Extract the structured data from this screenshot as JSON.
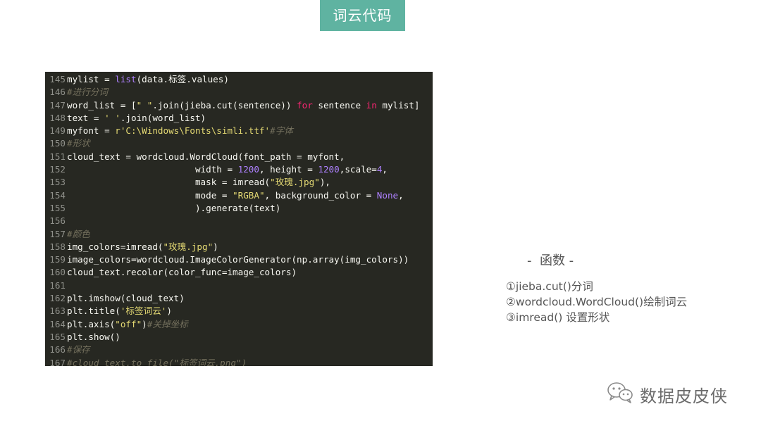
{
  "header": {
    "title": "词云代码"
  },
  "code": {
    "lines": [
      {
        "num": "145",
        "tokens": [
          {
            "t": "plain",
            "text": "mylist = "
          },
          {
            "t": "builtin",
            "text": "list"
          },
          {
            "t": "plain",
            "text": "(data.标签.values)"
          }
        ]
      },
      {
        "num": "146",
        "tokens": [
          {
            "t": "cmt",
            "text": "#进行分词"
          }
        ]
      },
      {
        "num": "147",
        "tokens": [
          {
            "t": "plain",
            "text": "word_list = ["
          },
          {
            "t": "str",
            "text": "\" \""
          },
          {
            "t": "plain",
            "text": ".join(jieba.cut(sentence)) "
          },
          {
            "t": "kw",
            "text": "for"
          },
          {
            "t": "plain",
            "text": " sentence "
          },
          {
            "t": "kw",
            "text": "in"
          },
          {
            "t": "plain",
            "text": " mylist]"
          }
        ]
      },
      {
        "num": "148",
        "tokens": [
          {
            "t": "plain",
            "text": "text = "
          },
          {
            "t": "str",
            "text": "' '"
          },
          {
            "t": "plain",
            "text": ".join(word_list)"
          }
        ]
      },
      {
        "num": "149",
        "tokens": [
          {
            "t": "plain",
            "text": "myfont = "
          },
          {
            "t": "str",
            "text": "r'C:\\Windows\\Fonts\\simli.ttf'"
          },
          {
            "t": "cmt",
            "text": "#字体"
          }
        ]
      },
      {
        "num": "150",
        "tokens": [
          {
            "t": "cmt",
            "text": "#形状"
          }
        ]
      },
      {
        "num": "151",
        "tokens": [
          {
            "t": "plain",
            "text": "cloud_text = wordcloud.WordCloud(font_path = myfont,"
          }
        ]
      },
      {
        "num": "152",
        "tokens": [
          {
            "t": "plain",
            "text": "                        width = "
          },
          {
            "t": "num",
            "text": "1200"
          },
          {
            "t": "plain",
            "text": ", height = "
          },
          {
            "t": "num",
            "text": "1200"
          },
          {
            "t": "plain",
            "text": ",scale="
          },
          {
            "t": "num",
            "text": "4"
          },
          {
            "t": "plain",
            "text": ","
          }
        ]
      },
      {
        "num": "153",
        "tokens": [
          {
            "t": "plain",
            "text": "                        mask = imread("
          },
          {
            "t": "str",
            "text": "\"玫瑰.jpg\""
          },
          {
            "t": "plain",
            "text": "),"
          }
        ]
      },
      {
        "num": "154",
        "tokens": [
          {
            "t": "plain",
            "text": "                        mode = "
          },
          {
            "t": "str",
            "text": "\"RGBA\""
          },
          {
            "t": "plain",
            "text": ", background_color = "
          },
          {
            "t": "const",
            "text": "None"
          },
          {
            "t": "plain",
            "text": ","
          }
        ]
      },
      {
        "num": "155",
        "tokens": [
          {
            "t": "plain",
            "text": "                        ).generate(text)"
          }
        ]
      },
      {
        "num": "156",
        "tokens": []
      },
      {
        "num": "157",
        "tokens": [
          {
            "t": "cmt",
            "text": "#颜色"
          }
        ]
      },
      {
        "num": "158",
        "tokens": [
          {
            "t": "plain",
            "text": "img_colors=imread("
          },
          {
            "t": "str",
            "text": "\"玫瑰.jpg\""
          },
          {
            "t": "plain",
            "text": ")"
          }
        ]
      },
      {
        "num": "159",
        "tokens": [
          {
            "t": "plain",
            "text": "image_colors=wordcloud.ImageColorGenerator(np.array(img_colors))"
          }
        ]
      },
      {
        "num": "160",
        "tokens": [
          {
            "t": "plain",
            "text": "cloud_text.recolor(color_func=image_colors)"
          }
        ]
      },
      {
        "num": "161",
        "tokens": []
      },
      {
        "num": "162",
        "tokens": [
          {
            "t": "plain",
            "text": "plt.imshow(cloud_text)"
          }
        ]
      },
      {
        "num": "163",
        "tokens": [
          {
            "t": "plain",
            "text": "plt.title("
          },
          {
            "t": "str",
            "text": "'标签词云'"
          },
          {
            "t": "plain",
            "text": ")"
          }
        ]
      },
      {
        "num": "164",
        "tokens": [
          {
            "t": "plain",
            "text": "plt.axis("
          },
          {
            "t": "str",
            "text": "\"off\""
          },
          {
            "t": "plain",
            "text": ")"
          },
          {
            "t": "cmt",
            "text": "#关掉坐标"
          }
        ]
      },
      {
        "num": "165",
        "tokens": [
          {
            "t": "plain",
            "text": "plt.show()"
          }
        ]
      },
      {
        "num": "166",
        "tokens": [
          {
            "t": "cmt",
            "text": "#保存"
          }
        ]
      },
      {
        "num": "167",
        "tokens": [
          {
            "t": "cmt",
            "text": "#cloud_text.to_file(\"标签词云.png\")"
          }
        ]
      }
    ]
  },
  "functions": {
    "heading": "-  函数 -",
    "items": [
      "①jieba.cut()分词",
      "②wordcloud.WordCloud()绘制词云",
      "③imread() 设置形状"
    ]
  },
  "watermark": {
    "text": "数据皮皮侠",
    "icon": "wechat-icon"
  },
  "colors": {
    "title_bg": "#5fb3a1",
    "code_bg": "#272822",
    "string": "#e6db74",
    "number": "#ae81ff",
    "keyword": "#f92672",
    "comment": "#75715e"
  }
}
